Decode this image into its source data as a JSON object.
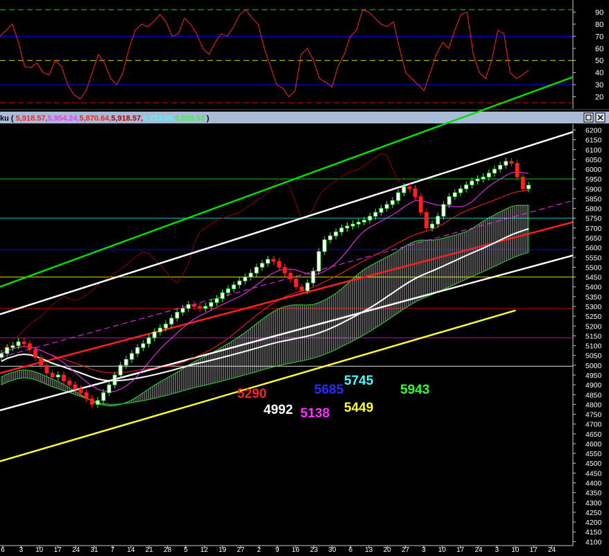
{
  "header": {
    "title_prefix": "ku (",
    "title_suffix": ")",
    "values": [
      {
        "text": "5,918.57,",
        "color": "#ff2020"
      },
      {
        "text": "5,954.24,",
        "color": "#ff30ff"
      },
      {
        "text": "5,870.64,",
        "color": "#ff2020"
      },
      {
        "text": "5,918.57,",
        "color": "#aa0000"
      },
      {
        "text": "5,773.96,",
        "color": "#40ffff"
      },
      {
        "text": "5,659.53",
        "color": "#30ff30"
      }
    ],
    "controls": [
      "restore-icon",
      "close-icon"
    ]
  },
  "x_axis": {
    "labels": [
      "6",
      "3",
      "10",
      "17",
      "24",
      "31",
      "7",
      "14",
      "21",
      "28",
      "5",
      "12",
      "19",
      "27",
      "2",
      "9",
      "16",
      "23",
      "30",
      "6",
      "13",
      "20",
      "27",
      "3",
      "10",
      "17",
      "24",
      "3",
      "10",
      "17",
      "24"
    ]
  },
  "annotations": [
    {
      "text": "5290",
      "color": "#ff2020"
    },
    {
      "text": "4992",
      "color": "#ffffff"
    },
    {
      "text": "5138",
      "color": "#ff30ff"
    },
    {
      "text": "5685",
      "color": "#2a2aff"
    },
    {
      "text": "5745",
      "color": "#40ffff"
    },
    {
      "text": "5449",
      "color": "#ffff30"
    },
    {
      "text": "5943",
      "color": "#30ff30"
    }
  ],
  "chart_data": [
    {
      "type": "line",
      "panel": "oscillator",
      "ylim": [
        10,
        100
      ],
      "yticks": [
        20,
        30,
        40,
        50,
        60,
        70,
        80,
        90
      ],
      "hlines": [
        {
          "value": 92,
          "color": "#00dd00",
          "style": "dashed"
        },
        {
          "value": 70,
          "color": "#0000ff",
          "style": "solid"
        },
        {
          "value": 50,
          "color": "#dddd00",
          "style": "dashed"
        },
        {
          "value": 30,
          "color": "#0000ff",
          "style": "solid"
        },
        {
          "value": 15,
          "color": "#dd0000",
          "style": "dashed"
        }
      ],
      "series": [
        {
          "color": "#ff2020",
          "values": [
            70,
            75,
            80,
            65,
            45,
            44,
            48,
            40,
            38,
            50,
            45,
            30,
            22,
            18,
            25,
            40,
            55,
            48,
            35,
            30,
            40,
            60,
            75,
            80,
            78,
            82,
            88,
            82,
            70,
            72,
            85,
            80,
            72,
            60,
            55,
            65,
            72,
            70,
            78,
            88,
            92,
            85,
            80,
            60,
            45,
            30,
            27,
            20,
            25,
            55,
            60,
            50,
            35,
            32,
            28,
            45,
            55,
            70,
            75,
            92,
            90,
            85,
            80,
            78,
            82,
            60,
            40,
            35,
            30,
            25,
            40,
            55,
            65,
            60,
            75,
            88,
            90,
            55,
            40,
            35,
            50,
            75,
            72,
            40,
            35,
            38,
            42
          ]
        }
      ]
    },
    {
      "type": "candlestick",
      "panel": "price",
      "ylim": [
        4080,
        6230
      ],
      "yticks": [
        4100,
        4150,
        4200,
        4250,
        4300,
        4350,
        4400,
        4450,
        4500,
        4550,
        4600,
        4650,
        4700,
        4750,
        4800,
        4850,
        4900,
        4950,
        5000,
        5050,
        5100,
        5150,
        5200,
        5250,
        5300,
        5350,
        5400,
        5450,
        5500,
        5550,
        5600,
        5650,
        5700,
        5750,
        5800,
        5850,
        5900,
        5950,
        6000,
        6050,
        6100,
        6150,
        6200
      ],
      "hlines": [
        {
          "value": 5950,
          "color": "#00cc00"
        },
        {
          "value": 5750,
          "color": "#00cccc"
        },
        {
          "value": 5590,
          "color": "#0000ff"
        },
        {
          "value": 5450,
          "color": "#dddd00"
        },
        {
          "value": 5290,
          "color": "#cc0000"
        },
        {
          "value": 5140,
          "color": "#cc00cc"
        },
        {
          "value": 4995,
          "color": "#dddddd"
        }
      ],
      "series": [
        {
          "name": "close",
          "values": [
            5060,
            5090,
            5100,
            5120,
            5110,
            5080,
            5040,
            5000,
            4960,
            4940,
            4950,
            4920,
            4900,
            4880,
            4860,
            4830,
            4800,
            4820,
            4860,
            4900,
            4950,
            5000,
            5030,
            5060,
            5090,
            5110,
            5140,
            5170,
            5190,
            5210,
            5240,
            5270,
            5290,
            5310,
            5300,
            5290,
            5300,
            5320,
            5340,
            5370,
            5390,
            5410,
            5430,
            5450,
            5470,
            5500,
            5520,
            5540,
            5530,
            5500,
            5470,
            5440,
            5400,
            5380,
            5420,
            5480,
            5580,
            5640,
            5660,
            5680,
            5700,
            5710,
            5720,
            5730,
            5740,
            5760,
            5780,
            5800,
            5820,
            5840,
            5880,
            5910,
            5900,
            5860,
            5780,
            5700,
            5720,
            5760,
            5820,
            5860,
            5880,
            5900,
            5920,
            5940,
            5950,
            5960,
            5980,
            6000,
            6020,
            6040,
            6030,
            5960,
            5900,
            5918
          ]
        }
      ],
      "trendlines": [
        {
          "color": "#00dd00",
          "from": [
            0,
            5400
          ],
          "to": [
            1,
            6470
          ]
        },
        {
          "color": "#ffffff",
          "from": [
            0,
            5260
          ],
          "to": [
            1,
            6190
          ]
        },
        {
          "color": "#ff30ff",
          "style": "dashed",
          "from": [
            0,
            5040
          ],
          "to": [
            1,
            5840
          ]
        },
        {
          "color": "#ff2020",
          "from": [
            0,
            4960
          ],
          "to": [
            1,
            5730
          ]
        },
        {
          "color": "#ffffff",
          "from": [
            0,
            4770
          ],
          "to": [
            1,
            5560
          ]
        },
        {
          "color": "#ffff30",
          "from": [
            0,
            4510
          ],
          "to": [
            0.9,
            5280
          ]
        }
      ]
    }
  ]
}
